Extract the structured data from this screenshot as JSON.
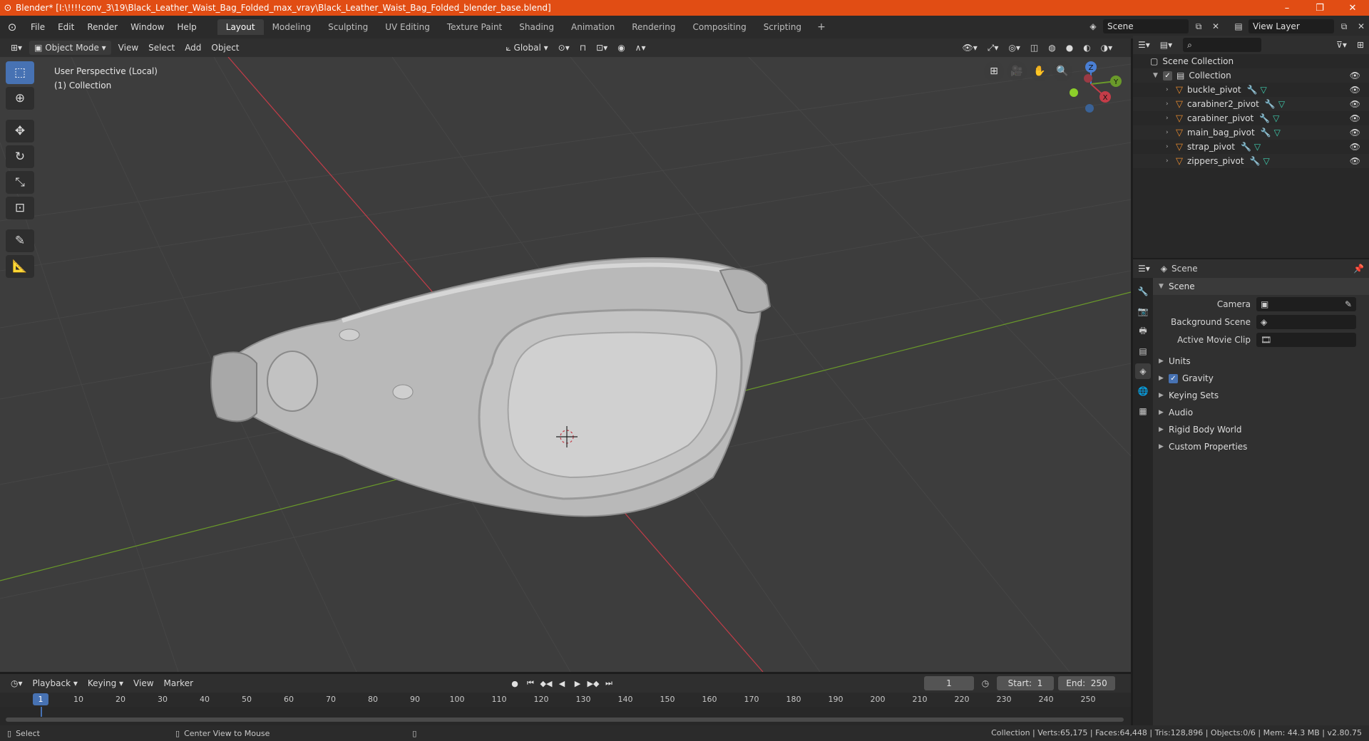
{
  "window": {
    "title": "Blender* [I:\\!!!!conv_3\\19\\Black_Leather_Waist_Bag_Folded_max_vray\\Black_Leather_Waist_Bag_Folded_blender_base.blend]",
    "minimize": "–",
    "maximize": "❐",
    "close": "✕"
  },
  "menu": [
    "File",
    "Edit",
    "Render",
    "Window",
    "Help"
  ],
  "workspaces": [
    "Layout",
    "Modeling",
    "Sculpting",
    "UV Editing",
    "Texture Paint",
    "Shading",
    "Animation",
    "Rendering",
    "Compositing",
    "Scripting"
  ],
  "active_workspace": "Layout",
  "scene_selector": {
    "label": "Scene"
  },
  "view_layer": {
    "label": "View Layer"
  },
  "viewport_header": {
    "mode": "Object Mode",
    "menus": [
      "View",
      "Select",
      "Add",
      "Object"
    ],
    "orientation": "Global"
  },
  "viewport": {
    "perspective": "User Perspective (Local)",
    "collection": "(1) Collection"
  },
  "gizmo": {
    "z": "Z",
    "y": "Y",
    "x": "X"
  },
  "outliner": {
    "root": "Scene Collection",
    "collection": "Collection",
    "objects": [
      "buckle_pivot",
      "carabiner2_pivot",
      "carabiner_pivot",
      "main_bag_pivot",
      "strap_pivot",
      "zippers_pivot"
    ]
  },
  "properties": {
    "header": "Scene",
    "panel": "Scene",
    "camera_label": "Camera",
    "bg_scene_label": "Background Scene",
    "movie_clip_label": "Active Movie Clip",
    "subpanels": {
      "units": "Units",
      "gravity": "Gravity",
      "keying_sets": "Keying Sets",
      "audio": "Audio",
      "rigid_body": "Rigid Body World",
      "custom_props": "Custom Properties"
    }
  },
  "timeline": {
    "menus": [
      "Playback",
      "Keying",
      "View",
      "Marker"
    ],
    "current_frame": "1",
    "start_label": "Start:",
    "start": "1",
    "end_label": "End:",
    "end": "250",
    "ticks": [
      "10",
      "20",
      "30",
      "40",
      "50",
      "60",
      "70",
      "80",
      "90",
      "100",
      "110",
      "120",
      "130",
      "140",
      "150",
      "160",
      "170",
      "180",
      "190",
      "200",
      "210",
      "220",
      "230",
      "240",
      "250"
    ]
  },
  "statusbar": {
    "select": "Select",
    "center_view": "Center View to Mouse",
    "stats": "Collection | Verts:65,175 | Faces:64,448 | Tris:128,896 | Objects:0/6 | Mem: 44.3 MB | v2.80.75"
  },
  "colors": {
    "titlebar": "#e14d14",
    "accent": "#4772b3",
    "x_axis": "#c43c48",
    "y_axis": "#6a9a2a"
  }
}
